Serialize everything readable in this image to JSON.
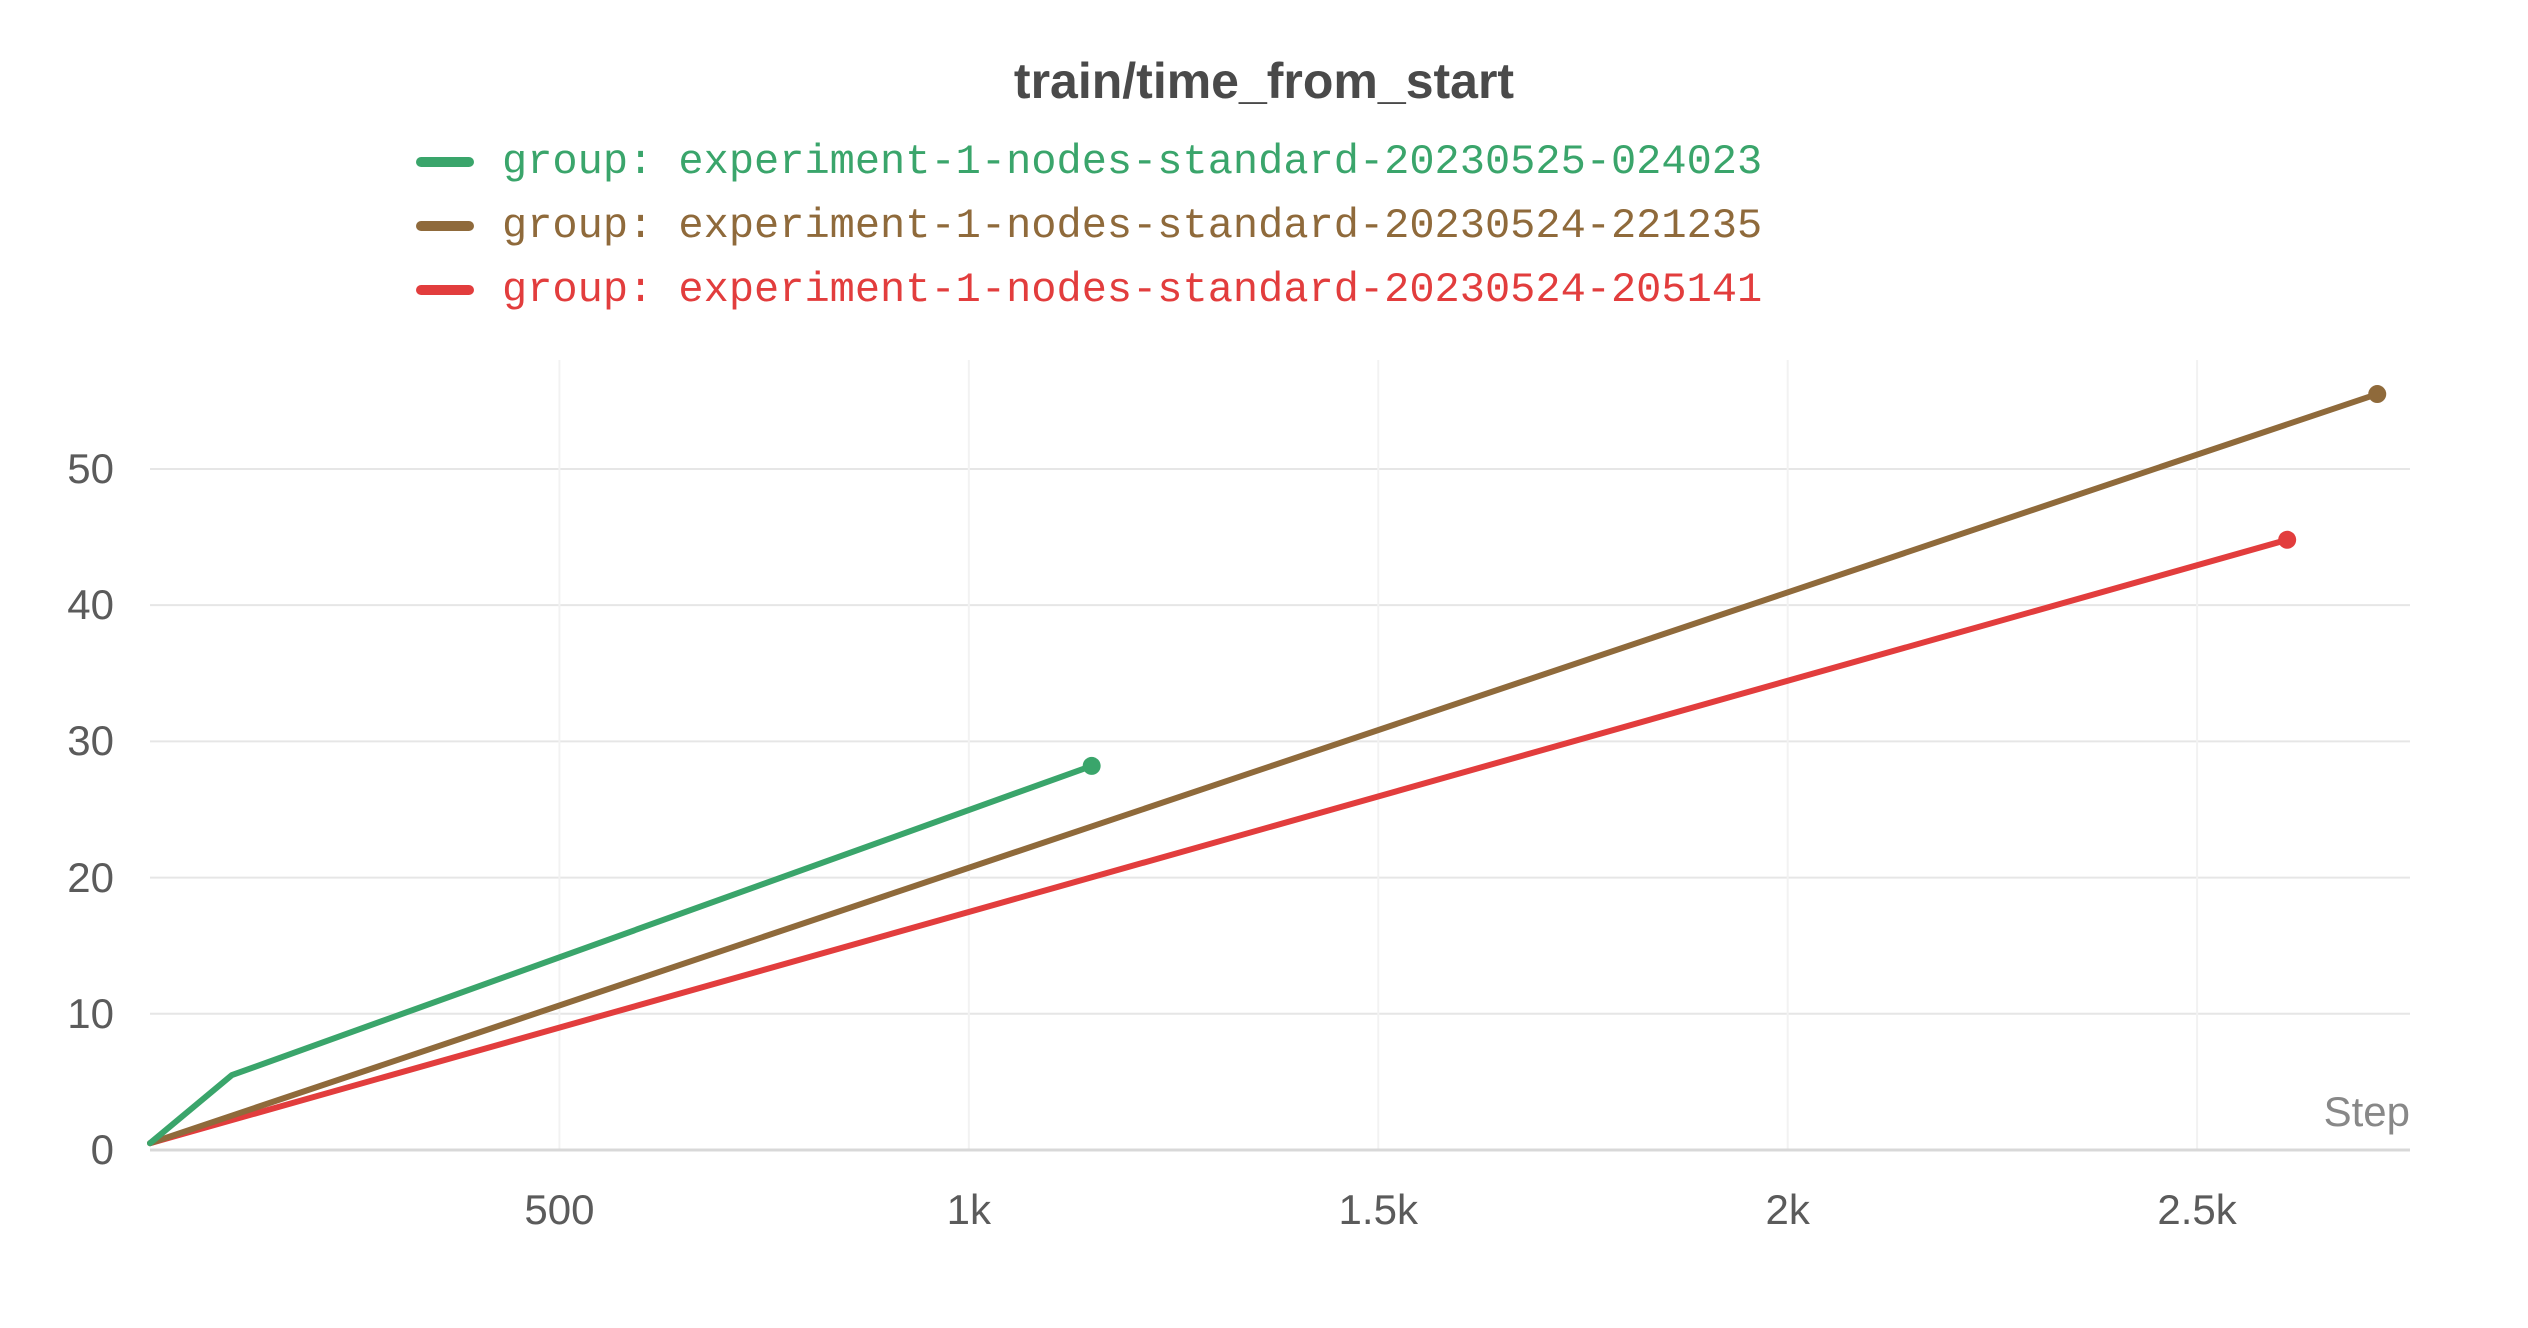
{
  "chart_data": {
    "type": "line",
    "title": "train/time_from_start",
    "xlabel": "Step",
    "ylabel": "",
    "xlim": [
      0,
      2760
    ],
    "ylim": [
      0,
      58
    ],
    "x_ticks": [
      500,
      1000,
      1500,
      2000,
      2500
    ],
    "x_tick_labels": [
      "500",
      "1k",
      "1.5k",
      "2k",
      "2.5k"
    ],
    "y_ticks": [
      0,
      10,
      20,
      30,
      40,
      50
    ],
    "y_tick_labels": [
      "0",
      "10",
      "20",
      "30",
      "40",
      "50"
    ],
    "series": [
      {
        "name": "group: experiment-1-nodes-standard-20230525-024023",
        "color": "#3aa56b",
        "x": [
          0,
          100,
          1150
        ],
        "values": [
          0.5,
          5.5,
          28.2
        ]
      },
      {
        "name": "group: experiment-1-nodes-standard-20230524-221235",
        "color": "#8f6a3b",
        "x": [
          0,
          2720
        ],
        "values": [
          0.5,
          55.5
        ]
      },
      {
        "name": "group: experiment-1-nodes-standard-20230524-205141",
        "color": "#e23d3d",
        "x": [
          0,
          2610
        ],
        "values": [
          0.5,
          44.8
        ]
      }
    ]
  }
}
